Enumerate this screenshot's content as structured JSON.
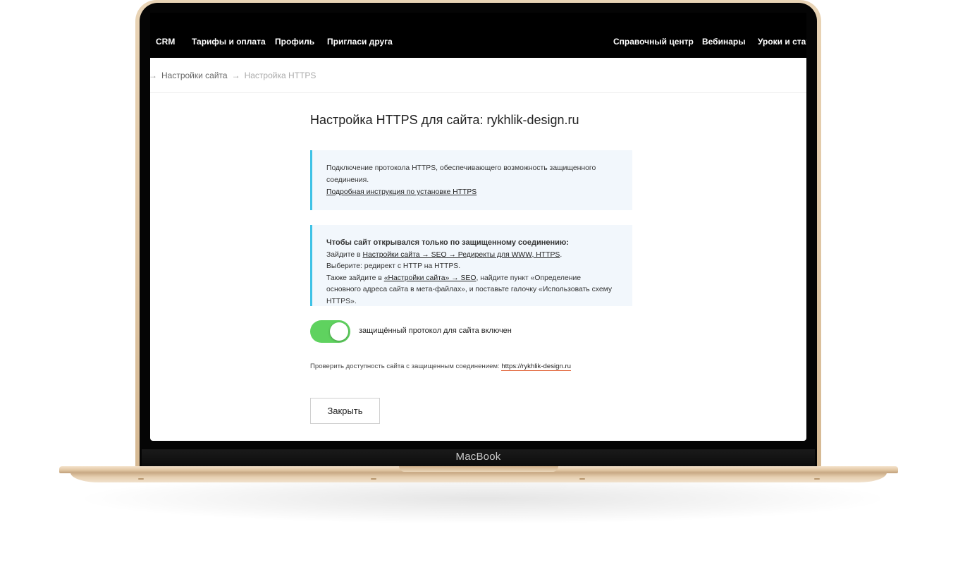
{
  "nav": {
    "left": [
      "CRM",
      "Тарифы и оплата",
      "Профиль",
      "Пригласи друга"
    ],
    "right": [
      "Справочный центр",
      "Вебинары",
      "Уроки и стат"
    ]
  },
  "breadcrumb": {
    "arrow": "→",
    "link": "Настройки сайта",
    "current": "Настройка HTTPS"
  },
  "page": {
    "title": "Настройка HTTPS для сайта: rykhlik-design.ru"
  },
  "info1": {
    "text": "Подключение протокола HTTPS, обеспечивающего возможность защищенного соединения.",
    "link": "Подробная инструкция по установке HTTPS"
  },
  "info2": {
    "heading": "Чтобы сайт открывался только по защищенному соединению:",
    "line1_prefix": "Зайдите в ",
    "line1_link": "Настройки сайта → SEO → Редиректы для WWW, HTTPS",
    "line1_suffix": ".",
    "line2": "Выберите: редирект с HTTP на HTTPS.",
    "line3_prefix": "Также зайдите в ",
    "line3_link": "«Настройки сайта» → SEO",
    "line3_suffix": ", найдите пункт «Определение основного адреса сайта в мета-файлах», и поставьте галочку «Использовать схему HTTPS»."
  },
  "toggle": {
    "on": true,
    "label": "защищённый протокол для сайта включен",
    "color": "#5fd25f"
  },
  "check": {
    "text": "Проверить доступность сайта с защищенным соединением: ",
    "link": "https://rykhlik-design.ru"
  },
  "buttons": {
    "close": "Закрыть"
  },
  "device": {
    "label": "MacBook"
  }
}
